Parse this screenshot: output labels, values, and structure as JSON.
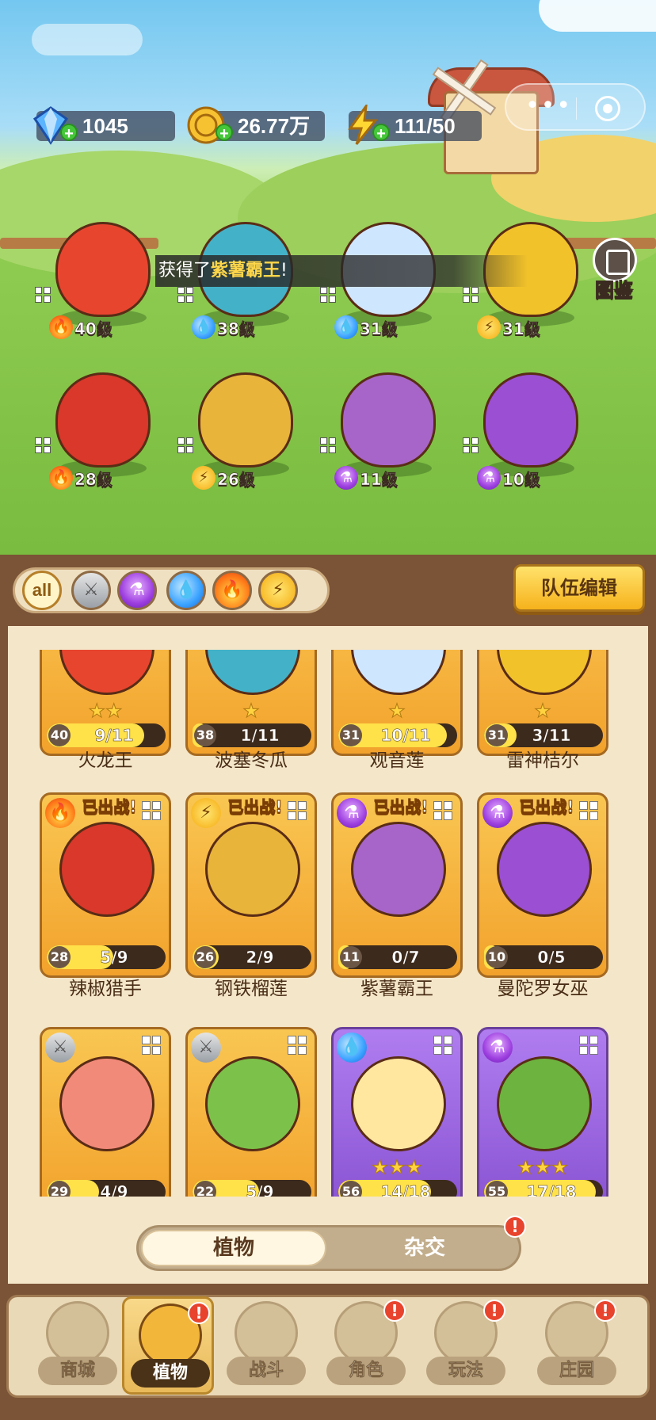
{
  "resources": {
    "gems": "1045",
    "coins": "26.77万",
    "energy": "111/50"
  },
  "top_right": {
    "codex_label": "图鉴"
  },
  "toast": {
    "prefix": "获得了",
    "highlight": "紫薯霸王",
    "suffix": "!"
  },
  "team": [
    {
      "element": "fire",
      "level": "40级",
      "color": "#e8452f"
    },
    {
      "element": "water",
      "level": "38级",
      "color": "#43b2c8"
    },
    {
      "element": "water",
      "level": "31级",
      "color": "#cfe6ff"
    },
    {
      "element": "bolt",
      "level": "31级",
      "color": "#f2c22a"
    },
    {
      "element": "fire",
      "level": "28级",
      "color": "#d9382a"
    },
    {
      "element": "bolt",
      "level": "26级",
      "color": "#e9b43a"
    },
    {
      "element": "poison",
      "level": "11级",
      "color": "#a765c9"
    },
    {
      "element": "poison",
      "level": "10级",
      "color": "#9b4fd2"
    }
  ],
  "filters": {
    "all_label": "all",
    "team_edit": "队伍编辑"
  },
  "plants": [
    {
      "name": "火龙王",
      "level": "40",
      "progress": "9/11",
      "frac": 0.82,
      "stars": "★★",
      "element": "",
      "deployed": "",
      "purple": false,
      "color": "#e8452f"
    },
    {
      "name": "波塞冬瓜",
      "level": "38",
      "progress": "1/11",
      "frac": 0.09,
      "stars": "★",
      "element": "",
      "deployed": "",
      "purple": false,
      "color": "#43b2c8"
    },
    {
      "name": "观音莲",
      "level": "31",
      "progress": "10/11",
      "frac": 0.91,
      "stars": "★",
      "element": "",
      "deployed": "",
      "purple": false,
      "color": "#cfe6ff"
    },
    {
      "name": "雷神桔尔",
      "level": "31",
      "progress": "3/11",
      "frac": 0.27,
      "stars": "★",
      "element": "",
      "deployed": "",
      "purple": false,
      "color": "#f2c22a"
    },
    {
      "name": "辣椒猎手",
      "level": "28",
      "progress": "5/9",
      "frac": 0.56,
      "stars": "",
      "element": "fire",
      "deployed": "已出战!",
      "purple": false,
      "color": "#d9382a"
    },
    {
      "name": "钢铁榴莲",
      "level": "26",
      "progress": "2/9",
      "frac": 0.22,
      "stars": "",
      "element": "bolt",
      "deployed": "已出战!",
      "purple": false,
      "color": "#e9b43a"
    },
    {
      "name": "紫薯霸王",
      "level": "11",
      "progress": "0/7",
      "frac": 0.0,
      "stars": "",
      "element": "poison",
      "deployed": "已出战!",
      "purple": false,
      "color": "#a765c9"
    },
    {
      "name": "曼陀罗女巫",
      "level": "10",
      "progress": "0/5",
      "frac": 0.0,
      "stars": "",
      "element": "poison",
      "deployed": "已出战!",
      "purple": false,
      "color": "#9b4fd2"
    },
    {
      "name": "",
      "level": "29",
      "progress": "4/9",
      "frac": 0.44,
      "stars": "",
      "element": "sword",
      "deployed": "",
      "purple": false,
      "color": "#f28a7a"
    },
    {
      "name": "",
      "level": "22",
      "progress": "5/9",
      "frac": 0.56,
      "stars": "",
      "element": "sword",
      "deployed": "",
      "purple": false,
      "color": "#7cc24a"
    },
    {
      "name": "",
      "level": "56",
      "progress": "14/18",
      "frac": 0.78,
      "stars": "★★★",
      "element": "water",
      "deployed": "",
      "purple": true,
      "color": "#ffe7a0"
    },
    {
      "name": "",
      "level": "55",
      "progress": "17/18",
      "frac": 0.94,
      "stars": "★★★",
      "element": "poison",
      "deployed": "",
      "purple": true,
      "color": "#6db33f"
    }
  ],
  "segment": {
    "active": "植物",
    "other": "杂交"
  },
  "nav": [
    {
      "label": "商城",
      "active": false,
      "badge": false
    },
    {
      "label": "植物",
      "active": true,
      "badge": true
    },
    {
      "label": "战斗",
      "active": false,
      "badge": false
    },
    {
      "label": "角色",
      "active": false,
      "badge": true
    },
    {
      "label": "玩法",
      "active": false,
      "badge": true
    },
    {
      "label": "庄园",
      "active": false,
      "badge": true
    }
  ]
}
